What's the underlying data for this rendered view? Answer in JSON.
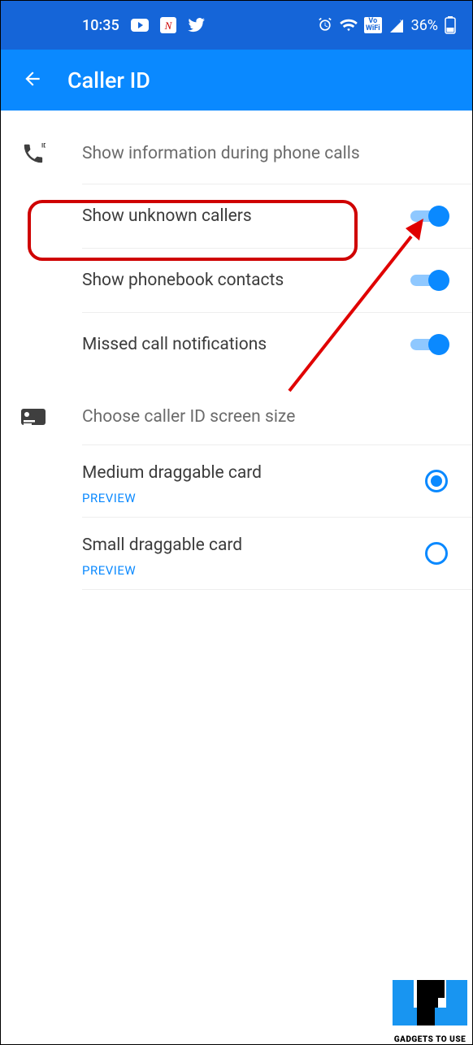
{
  "status": {
    "time": "10:35",
    "battery": "36%"
  },
  "header": {
    "title": "Caller ID"
  },
  "section1": {
    "label": "Show information during phone calls",
    "items": [
      {
        "label": "Show unknown callers",
        "on": true
      },
      {
        "label": "Show phonebook contacts",
        "on": true
      },
      {
        "label": "Missed call notifications",
        "on": true
      }
    ]
  },
  "section2": {
    "label": "Choose caller ID screen size",
    "preview_label": "PREVIEW",
    "items": [
      {
        "label": "Medium draggable card",
        "selected": true
      },
      {
        "label": "Small draggable card",
        "selected": false
      }
    ]
  },
  "watermark": "GADGETS TO USE"
}
